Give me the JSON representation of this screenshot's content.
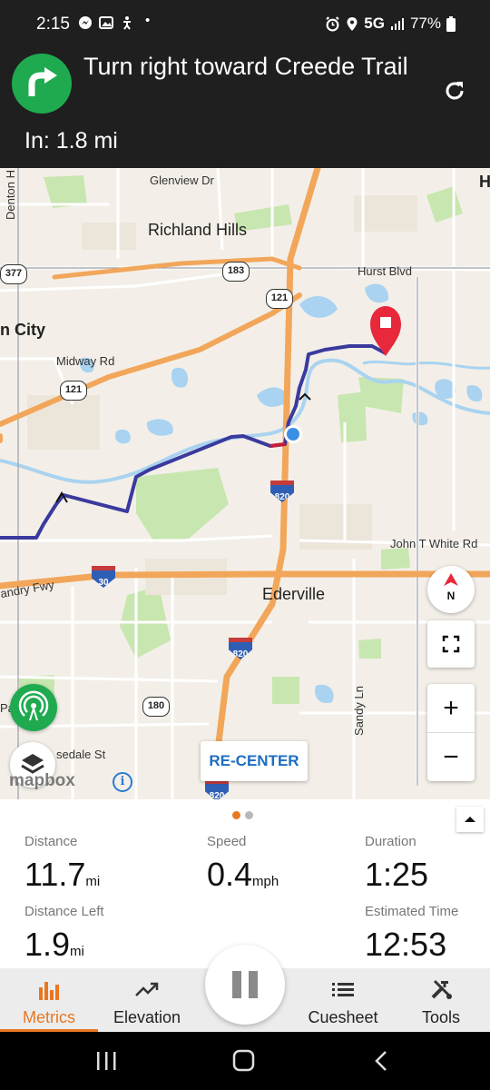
{
  "status_bar": {
    "time": "2:15",
    "network": "5G",
    "battery": "77%"
  },
  "turn": {
    "instruction": "Turn right toward Creede Trail",
    "distance": "In: 1.8 mi"
  },
  "map": {
    "labels": {
      "glenview": "Glenview Dr",
      "richland_hills": "Richland Hills",
      "hurst_blvd": "Hurst Blvd",
      "city": "n City",
      "midway": "Midway Rd",
      "john_t_white": "John T White Rd",
      "ederville": "Ederville",
      "andry_fwy": "andry Fwy",
      "sandy_ln": "Sandy Ln",
      "sedale": "sedale St",
      "denton": "Denton H",
      "pa": "Pa",
      "h": "H"
    },
    "shields": {
      "us377": "377",
      "r183": "183",
      "r121a": "121",
      "r121b": "121",
      "r180": "180",
      "i820a": "820",
      "i820b": "820",
      "i820c": "820",
      "i30": "30"
    },
    "compass_label": "N",
    "recenter_label": "RE-CENTER",
    "attribution": "mapbox",
    "info_symbol": "i",
    "zoom_in": "+",
    "zoom_out": "−"
  },
  "metrics": {
    "distance": {
      "label": "Distance",
      "value": "11.7",
      "unit": "mi"
    },
    "speed": {
      "label": "Speed",
      "value": "0.4",
      "unit": "mph"
    },
    "duration": {
      "label": "Duration",
      "value": "1:25"
    },
    "distance_left": {
      "label": "Distance Left",
      "value": "1.9",
      "unit": "mi"
    },
    "estimated_time": {
      "label": "Estimated Time",
      "value": "12:53"
    },
    "page_indicator": {
      "current": 1,
      "total": 2
    }
  },
  "nav": {
    "metrics": "Metrics",
    "elevation": "Elevation",
    "cuesheet": "Cuesheet",
    "tools": "Tools"
  },
  "colors": {
    "accent": "#e87722",
    "turn_green": "#1faa4f",
    "route": "#3a3a9e",
    "highway": "#f2a65a",
    "water": "#a9d3f0",
    "park": "#c8e6b0",
    "destination": "#e8283b",
    "recenter": "#1e6dc2"
  }
}
